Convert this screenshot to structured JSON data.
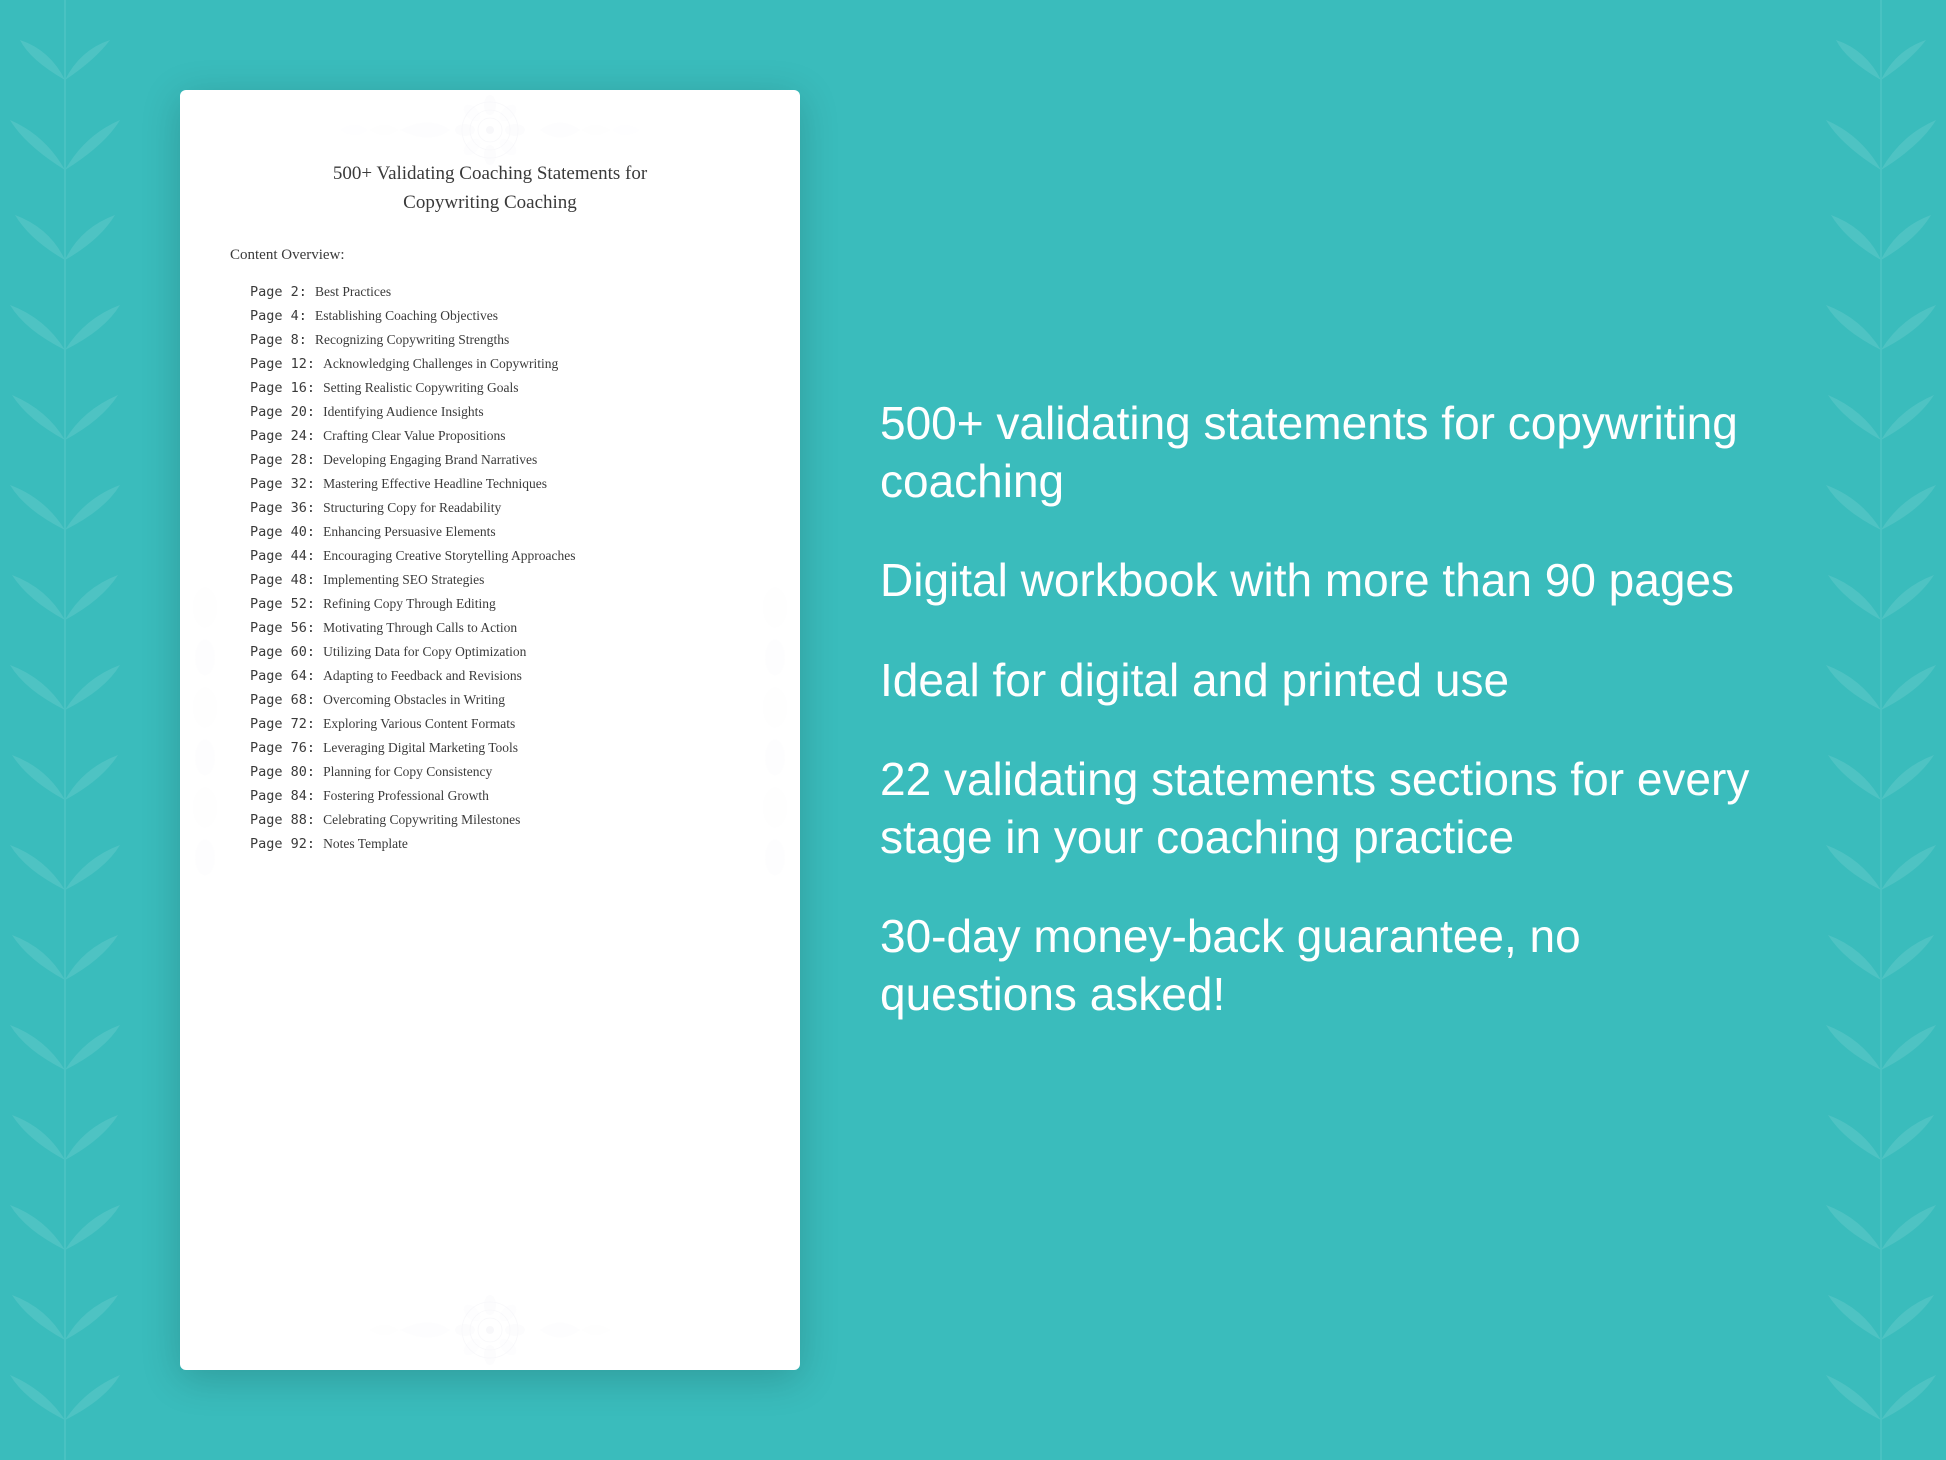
{
  "background_color": "#3abcbc",
  "doc": {
    "title_line1": "500+ Validating Coaching Statements for",
    "title_line2": "Copywriting Coaching",
    "content_label": "Content Overview:",
    "toc_items": [
      {
        "page": "Page  2:",
        "topic": "Best Practices"
      },
      {
        "page": "Page  4:",
        "topic": "Establishing Coaching Objectives"
      },
      {
        "page": "Page  8:",
        "topic": "Recognizing Copywriting Strengths"
      },
      {
        "page": "Page 12:",
        "topic": "Acknowledging Challenges in Copywriting"
      },
      {
        "page": "Page 16:",
        "topic": "Setting Realistic Copywriting Goals"
      },
      {
        "page": "Page 20:",
        "topic": "Identifying Audience Insights"
      },
      {
        "page": "Page 24:",
        "topic": "Crafting Clear Value Propositions"
      },
      {
        "page": "Page 28:",
        "topic": "Developing Engaging Brand Narratives"
      },
      {
        "page": "Page 32:",
        "topic": "Mastering Effective Headline Techniques"
      },
      {
        "page": "Page 36:",
        "topic": "Structuring Copy for Readability"
      },
      {
        "page": "Page 40:",
        "topic": "Enhancing Persuasive Elements"
      },
      {
        "page": "Page 44:",
        "topic": "Encouraging Creative Storytelling Approaches"
      },
      {
        "page": "Page 48:",
        "topic": "Implementing SEO Strategies"
      },
      {
        "page": "Page 52:",
        "topic": "Refining Copy Through Editing"
      },
      {
        "page": "Page 56:",
        "topic": "Motivating Through Calls to Action"
      },
      {
        "page": "Page 60:",
        "topic": "Utilizing Data for Copy Optimization"
      },
      {
        "page": "Page 64:",
        "topic": "Adapting to Feedback and Revisions"
      },
      {
        "page": "Page 68:",
        "topic": "Overcoming Obstacles in Writing"
      },
      {
        "page": "Page 72:",
        "topic": "Exploring Various Content Formats"
      },
      {
        "page": "Page 76:",
        "topic": "Leveraging Digital Marketing Tools"
      },
      {
        "page": "Page 80:",
        "topic": "Planning for Copy Consistency"
      },
      {
        "page": "Page 84:",
        "topic": "Fostering Professional Growth"
      },
      {
        "page": "Page 88:",
        "topic": "Celebrating Copywriting Milestones"
      },
      {
        "page": "Page 92:",
        "topic": "Notes Template"
      }
    ]
  },
  "features": [
    {
      "id": "feature1",
      "text": "500+ validating statements for copywriting coaching"
    },
    {
      "id": "feature2",
      "text": "Digital workbook with more than 90 pages"
    },
    {
      "id": "feature3",
      "text": "Ideal for digital and printed use"
    },
    {
      "id": "feature4",
      "text": "22 validating statements sections for every stage in your coaching practice"
    },
    {
      "id": "feature5",
      "text": "30-day money-back guarantee, no questions asked!"
    }
  ]
}
